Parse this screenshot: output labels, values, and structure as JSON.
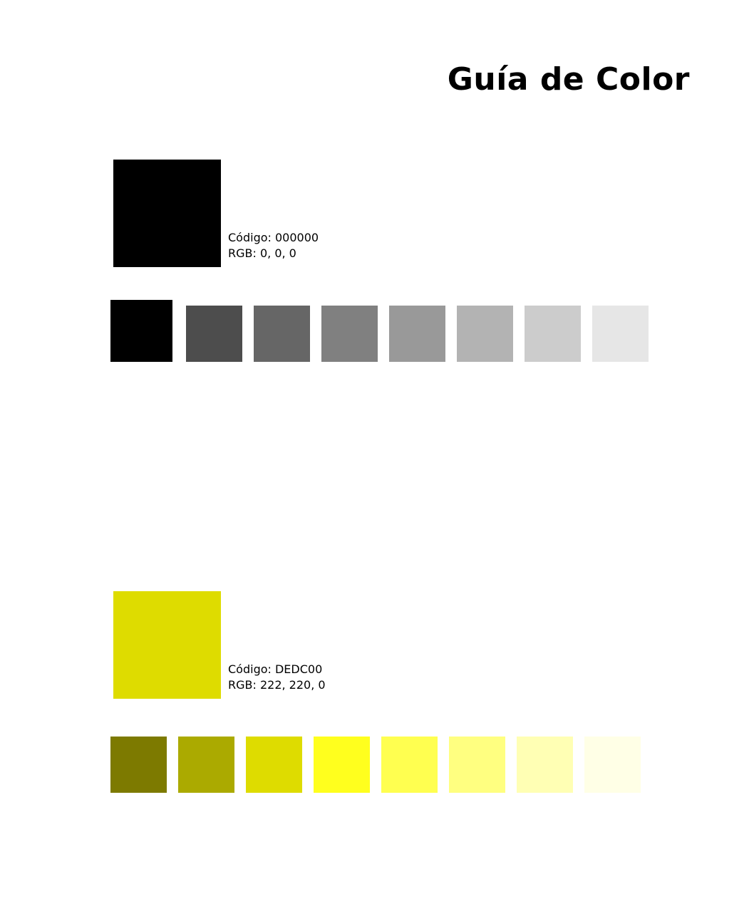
{
  "page": {
    "title": "Guía de Color"
  },
  "palettes": [
    {
      "id": "black",
      "main_color": "#000000",
      "code_text": "Código: 000000",
      "rgb_text": "RGB: 0, 0, 0",
      "tints": [
        "#000000",
        "#4d4d4d",
        "#666666",
        "#808080",
        "#999999",
        "#b3b3b3",
        "#cccccc",
        "#e6e6e6"
      ]
    },
    {
      "id": "yellow",
      "main_color": "#dedc00",
      "code_text": "Código: DEDC00",
      "rgb_text": "RGB: 222, 220, 0",
      "tints": [
        "#7d7a00",
        "#abaa00",
        "#dedc00",
        "#ffff1e",
        "#ffff50",
        "#ffff80",
        "#ffffb4",
        "#ffffe6"
      ]
    }
  ]
}
